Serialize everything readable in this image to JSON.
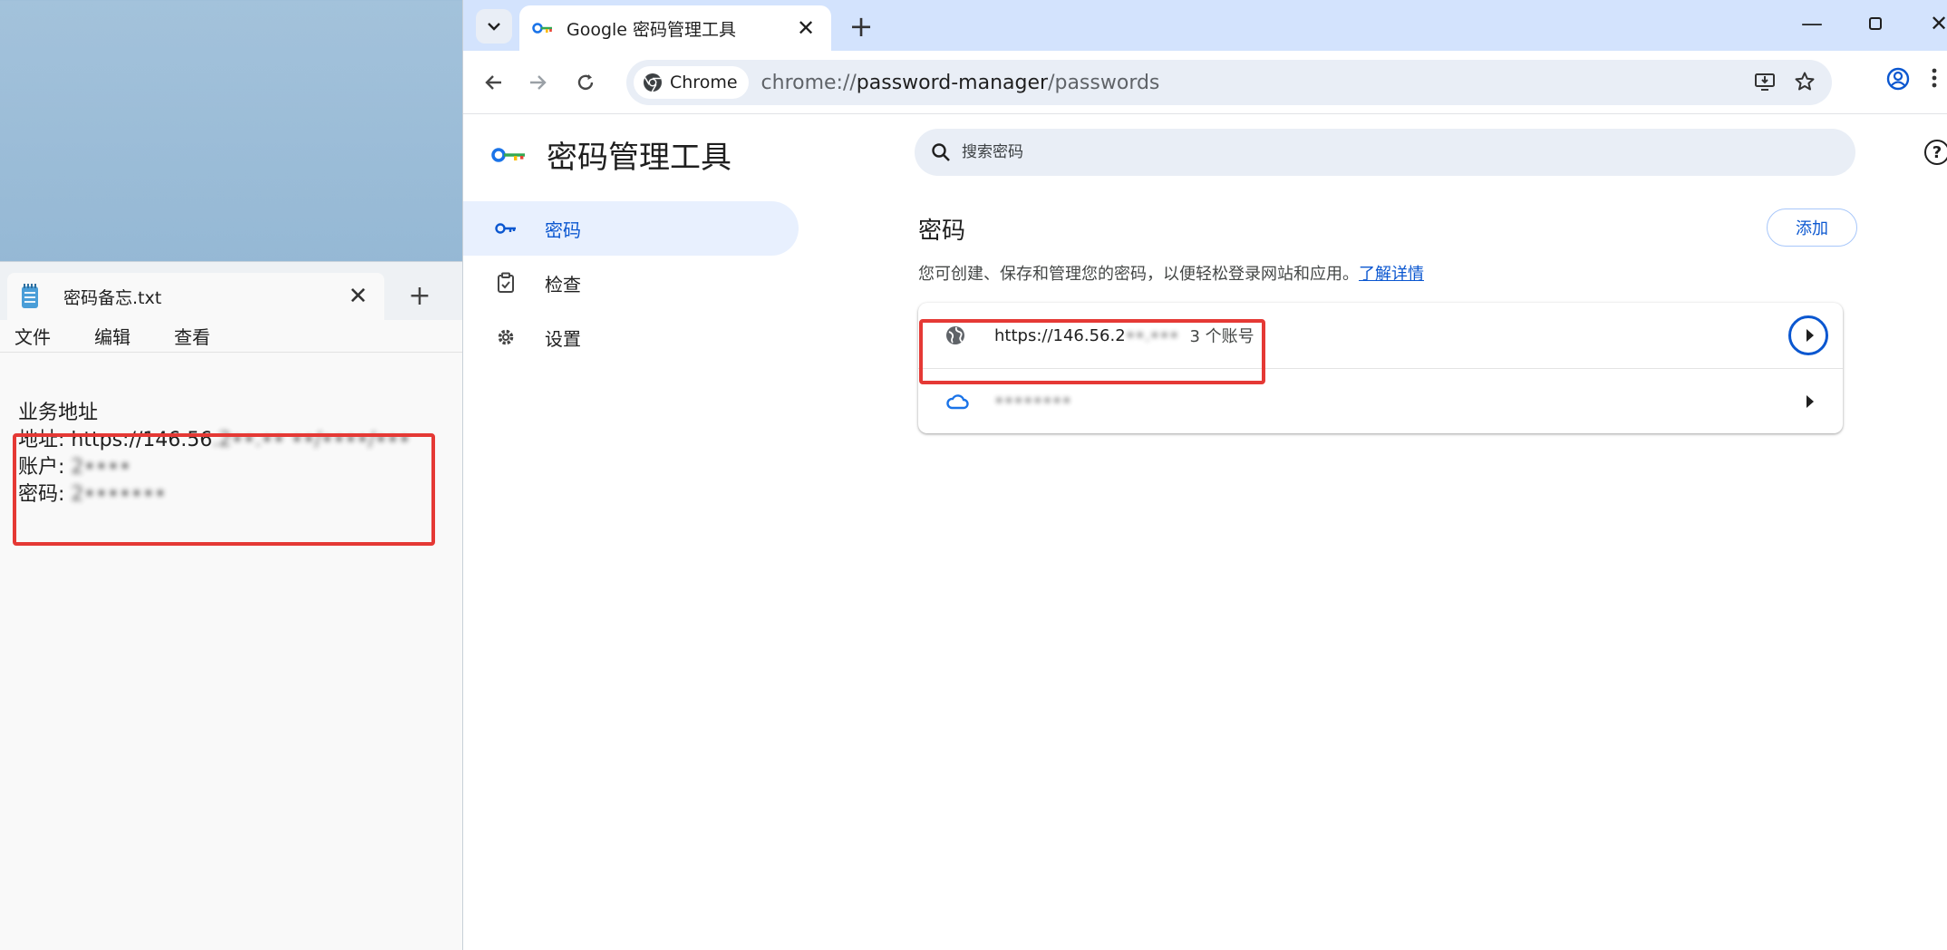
{
  "notepad": {
    "tab_title": "密码备忘.txt",
    "menu": [
      "文件",
      "编辑",
      "查看"
    ],
    "lines": {
      "heading": "业务地址",
      "address_label": "地址: https://146.56",
      "address_redacted": ".2••.•• ••/••••/•••",
      "account_label": "账户: ",
      "account_redacted": "2••••",
      "password_label": "密码: ",
      "password_redacted": "2•••••••"
    }
  },
  "chrome": {
    "tab_title": "Google 密码管理工具",
    "omnibox": {
      "chip_label": "Chrome",
      "url_prefix": "chrome://",
      "url_host": "password-manager",
      "url_path": "/passwords"
    }
  },
  "password_manager": {
    "title": "密码管理工具",
    "search_placeholder": "搜索密码",
    "nav": [
      {
        "label": "密码",
        "icon": "key-icon",
        "active": true
      },
      {
        "label": "检查",
        "icon": "clipboard-check-icon",
        "active": false
      },
      {
        "label": "设置",
        "icon": "gear-icon",
        "active": false
      }
    ],
    "section_title": "密码",
    "add_button": "添加",
    "description": "您可创建、保存和管理您的密码，以便轻松登录网站和应用。",
    "learn_more": "了解详情",
    "entries": [
      {
        "site": "https://146.56.2",
        "site_redacted": "••.•••",
        "count": "3 个账号",
        "icon": "globe-icon"
      },
      {
        "site_redacted": "••••••••",
        "icon": "cloud-icon"
      }
    ]
  },
  "colors": {
    "annotation_red": "#e53935",
    "accent_blue": "#0b57d0",
    "tabstrip_bg": "#d3e3fd",
    "active_nav_bg": "#e8f0fe"
  }
}
